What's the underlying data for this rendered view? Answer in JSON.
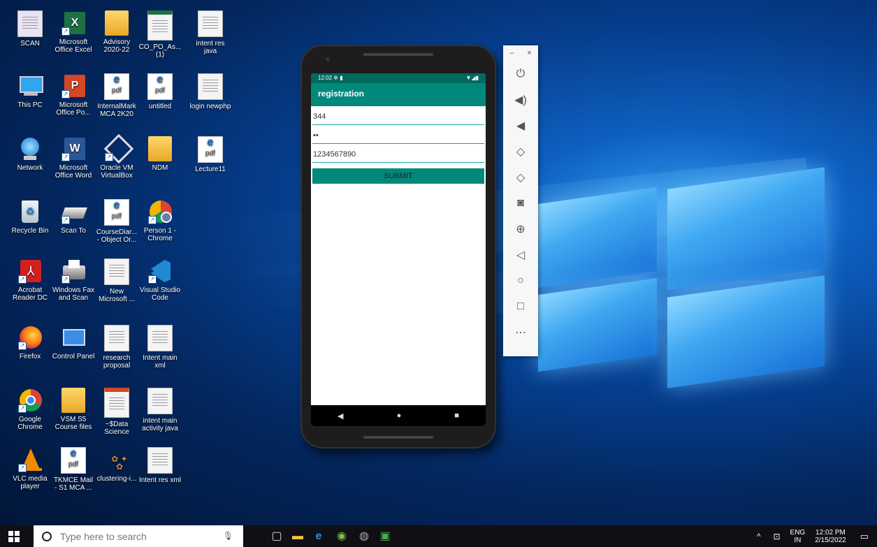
{
  "desktop_icons": [
    {
      "label": "SCAN"
    },
    {
      "label": "Microsoft Office Excel"
    },
    {
      "label": "Advisory 2020-22"
    },
    {
      "label": "CO_PO_As... (1)"
    },
    {
      "label": "intent res java"
    },
    {
      "label": "This PC"
    },
    {
      "label": "Microsoft Office Po..."
    },
    {
      "label": "InternalMark MCA 2K20"
    },
    {
      "label": "untitled"
    },
    {
      "label": "login newphp"
    },
    {
      "label": "Network"
    },
    {
      "label": "Microsoft Office Word"
    },
    {
      "label": "Oracle VM VirtualBox"
    },
    {
      "label": "NDM"
    },
    {
      "label": "Lecture11"
    },
    {
      "label": "Recycle Bin"
    },
    {
      "label": "Scan To"
    },
    {
      "label": "CourseDiar... - Object Or..."
    },
    {
      "label": "Person 1 - Chrome"
    },
    {
      "label": "Acrobat Reader DC"
    },
    {
      "label": "Windows Fax and Scan"
    },
    {
      "label": "New Microsoft ..."
    },
    {
      "label": "Visual Studio Code"
    },
    {
      "label": "Firefox"
    },
    {
      "label": "Control Panel"
    },
    {
      "label": "research proposal"
    },
    {
      "label": "Intent main xml"
    },
    {
      "label": "Google Chrome"
    },
    {
      "label": "VSM S5 Course files"
    },
    {
      "label": "~$Data Science"
    },
    {
      "label": "intent main activity java"
    },
    {
      "label": "VLC media player"
    },
    {
      "label": "TKMCE Mail - S1 MCA ..."
    },
    {
      "label": "clustering-i..."
    },
    {
      "label": "Intent res xml"
    }
  ],
  "pdf_text": "pdf",
  "emulator": {
    "status_time": "12:02",
    "app_title": "registration",
    "fields": [
      "344",
      "••",
      "1234567890"
    ],
    "submit_label": "SUBMIT"
  },
  "taskbar": {
    "search_placeholder": "Type here to search",
    "lang": "ENG",
    "region": "IN",
    "time": "12:02 PM",
    "date": "2/15/2022"
  },
  "colors": {
    "primary": "#00897b",
    "primary_dark": "#00695c"
  }
}
